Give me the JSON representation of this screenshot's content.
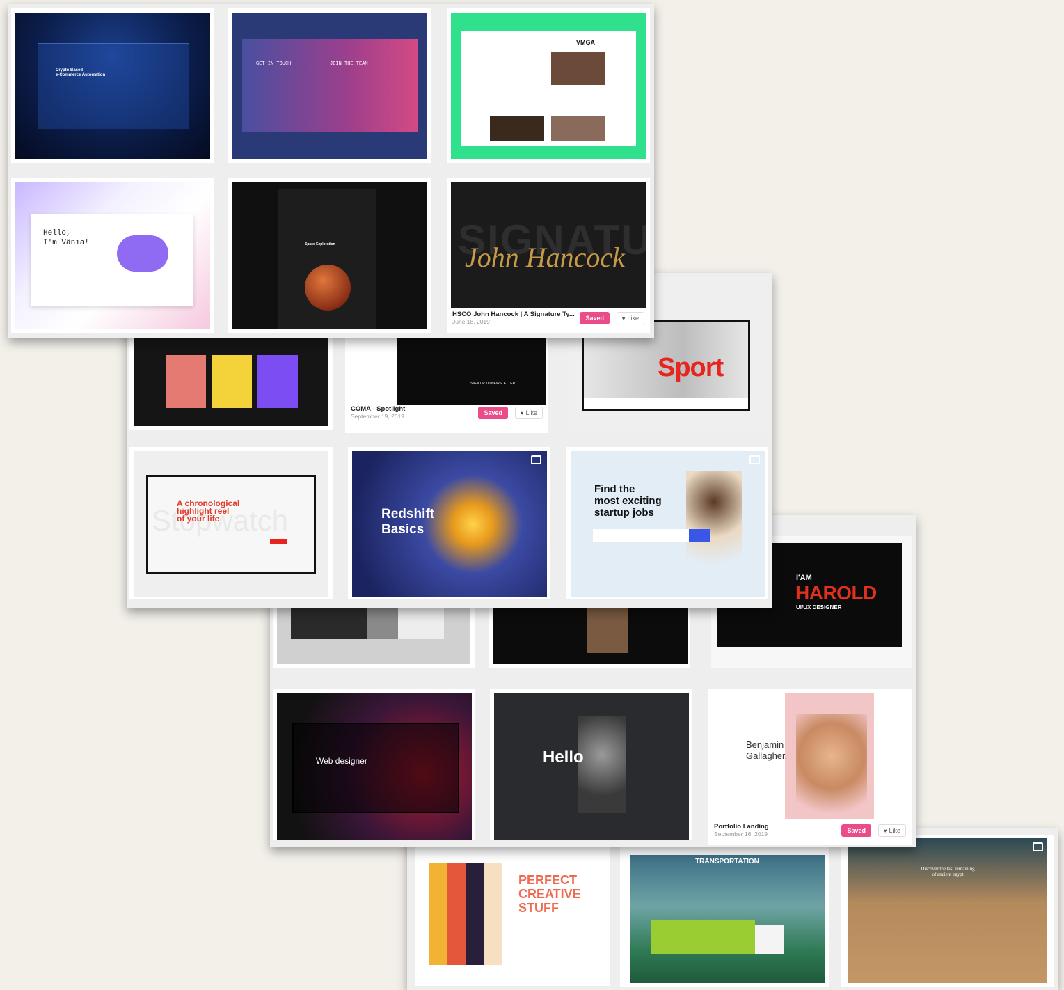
{
  "sheet4": {
    "tiles": [
      {
        "headline": "PERFECT\nCREATIVE\nSTUFF"
      },
      {
        "headline": "TRANSPORTATION"
      },
      {
        "headline": "Discover the last remaining\nof ancient egypt"
      }
    ]
  },
  "sheet3": {
    "row1": [
      {
        "text": ""
      },
      {
        "text": ""
      },
      {
        "line1": "I'AM",
        "line2": "HAROLD",
        "line3": "UI/UX DESIGNER"
      }
    ],
    "row2": [
      {
        "headline": "Web designer"
      },
      {
        "headline": "Hello"
      },
      {
        "headline": "Benjamin\nGallagher.",
        "title": "Portfolio Landing",
        "date": "September 16, 2019",
        "saved": "Saved",
        "like": "Like"
      }
    ]
  },
  "sheet2": {
    "row1": [
      {
        "text": ""
      },
      {
        "title": "COMA - Spotlight",
        "date": "September 19, 2019",
        "saved": "Saved",
        "like": "Like",
        "newsletter": "SIGN UP TO NEWSLETTER"
      },
      {
        "headline": "Sport"
      }
    ],
    "row2": [
      {
        "headline": "A chronological\nhighlight reel\nof your life",
        "bg_word": "Stopwatch"
      },
      {
        "headline": "Redshift\nBasics"
      },
      {
        "headline": "Find the\nmost exciting\nstartup jobs"
      }
    ]
  },
  "sheet1": {
    "row1": [
      {
        "headline": "Crypto Based\ne-Commerce Automation"
      },
      {
        "col1": "GET IN TOUCH",
        "col2": "JOIN THE TEAM"
      },
      {
        "brand": "VMGA"
      }
    ],
    "row2": [
      {
        "headline": "Hello,\nI'm Vânia!"
      },
      {
        "headline": "Space Exploration"
      },
      {
        "bg_word": "SIGNATURE",
        "script": "John Hancock",
        "title": "HSCO John Hancock | A Signature Ty...",
        "date": "June 18, 2019",
        "saved": "Saved",
        "like": "Like"
      }
    ]
  },
  "colors": {
    "accent_pink": "#ea4c89",
    "harold_red": "#e0301e",
    "sport_red": "#e8241f"
  },
  "icons": {
    "like": "heart-icon",
    "multi_shot": "multi-shot-icon"
  }
}
